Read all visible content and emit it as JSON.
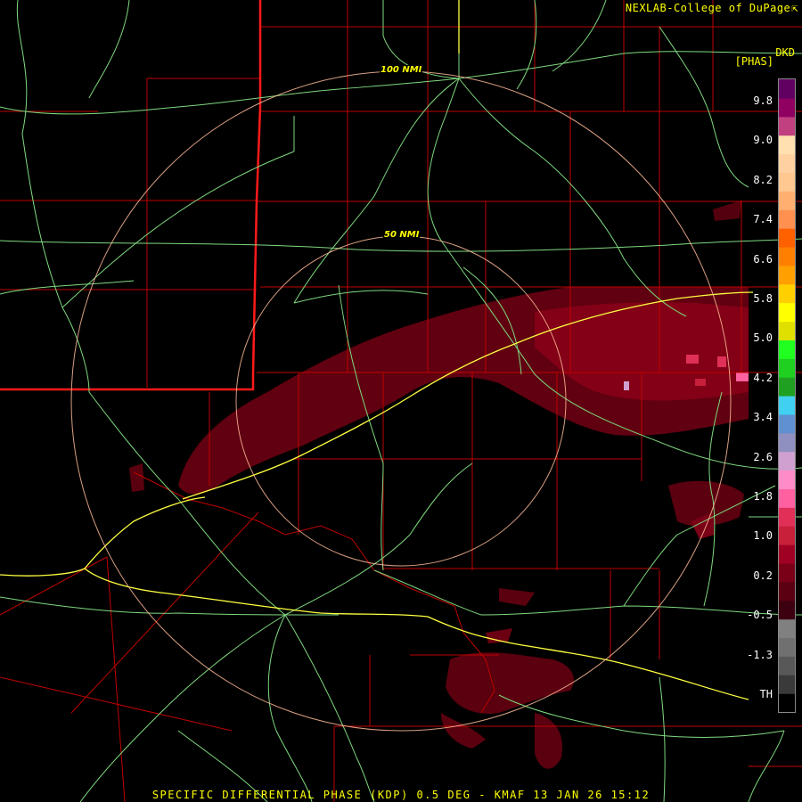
{
  "header": {
    "credit": "NEXLAB-College of DuPage",
    "credit_mark": "⇱"
  },
  "legend": {
    "product_code": "DKD",
    "unit": "[PHAS]",
    "tick_labels": [
      "9.8",
      "9.0",
      "8.2",
      "7.4",
      "6.6",
      "5.8",
      "5.0",
      "4.2",
      "3.4",
      "2.6",
      "1.8",
      "1.0",
      "0.2",
      "-0.5",
      "-1.3",
      "TH"
    ],
    "colors": [
      "#000000",
      "#3a3a3a",
      "#585858",
      "#707070",
      "#808080",
      "#3c0010",
      "#5a0012",
      "#7a0018",
      "#a00024",
      "#c8203a",
      "#e03058",
      "#ff60a0",
      "#ff8cc8",
      "#d0a0d0",
      "#9090c0",
      "#6090d0",
      "#40d0f0",
      "#20a020",
      "#20d020",
      "#20ff20",
      "#e0e000",
      "#ffff00",
      "#ffd000",
      "#ffa000",
      "#ff8000",
      "#ff6000",
      "#ff9050",
      "#ffb070",
      "#ffc890",
      "#ffd0a0",
      "#ffe0b0",
      "#c04080",
      "#900060",
      "#600060"
    ]
  },
  "range_rings": {
    "inner_label": "50 NMI",
    "outer_label": "100 NMI"
  },
  "footer": {
    "caption": "SPECIFIC DIFFERENTIAL PHASE (KDP) 0.5 DEG - KMAF 13 JAN 26 15:12"
  },
  "colors": {
    "background": "#000000",
    "county_lines": "#c00000",
    "state_line": "#ff0000",
    "roads": "#7fd97f",
    "interstates": "#ffff40",
    "range_rings": "#ffbb99",
    "text": "#ffff00"
  }
}
